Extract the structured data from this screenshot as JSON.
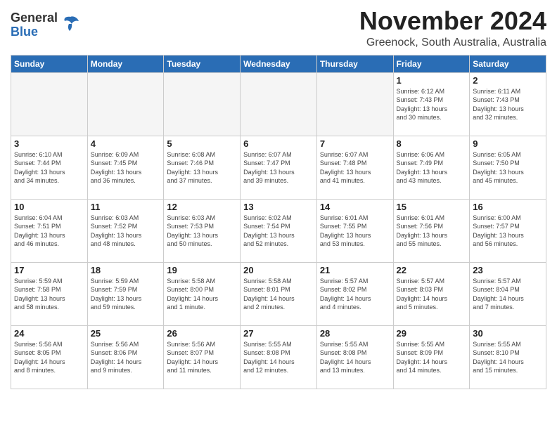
{
  "header": {
    "logo_general": "General",
    "logo_blue": "Blue",
    "month_title": "November 2024",
    "location": "Greenock, South Australia, Australia"
  },
  "days_of_week": [
    "Sunday",
    "Monday",
    "Tuesday",
    "Wednesday",
    "Thursday",
    "Friday",
    "Saturday"
  ],
  "weeks": [
    [
      {
        "day": "",
        "info": ""
      },
      {
        "day": "",
        "info": ""
      },
      {
        "day": "",
        "info": ""
      },
      {
        "day": "",
        "info": ""
      },
      {
        "day": "",
        "info": ""
      },
      {
        "day": "1",
        "info": "Sunrise: 6:12 AM\nSunset: 7:43 PM\nDaylight: 13 hours\nand 30 minutes."
      },
      {
        "day": "2",
        "info": "Sunrise: 6:11 AM\nSunset: 7:43 PM\nDaylight: 13 hours\nand 32 minutes."
      }
    ],
    [
      {
        "day": "3",
        "info": "Sunrise: 6:10 AM\nSunset: 7:44 PM\nDaylight: 13 hours\nand 34 minutes."
      },
      {
        "day": "4",
        "info": "Sunrise: 6:09 AM\nSunset: 7:45 PM\nDaylight: 13 hours\nand 36 minutes."
      },
      {
        "day": "5",
        "info": "Sunrise: 6:08 AM\nSunset: 7:46 PM\nDaylight: 13 hours\nand 37 minutes."
      },
      {
        "day": "6",
        "info": "Sunrise: 6:07 AM\nSunset: 7:47 PM\nDaylight: 13 hours\nand 39 minutes."
      },
      {
        "day": "7",
        "info": "Sunrise: 6:07 AM\nSunset: 7:48 PM\nDaylight: 13 hours\nand 41 minutes."
      },
      {
        "day": "8",
        "info": "Sunrise: 6:06 AM\nSunset: 7:49 PM\nDaylight: 13 hours\nand 43 minutes."
      },
      {
        "day": "9",
        "info": "Sunrise: 6:05 AM\nSunset: 7:50 PM\nDaylight: 13 hours\nand 45 minutes."
      }
    ],
    [
      {
        "day": "10",
        "info": "Sunrise: 6:04 AM\nSunset: 7:51 PM\nDaylight: 13 hours\nand 46 minutes."
      },
      {
        "day": "11",
        "info": "Sunrise: 6:03 AM\nSunset: 7:52 PM\nDaylight: 13 hours\nand 48 minutes."
      },
      {
        "day": "12",
        "info": "Sunrise: 6:03 AM\nSunset: 7:53 PM\nDaylight: 13 hours\nand 50 minutes."
      },
      {
        "day": "13",
        "info": "Sunrise: 6:02 AM\nSunset: 7:54 PM\nDaylight: 13 hours\nand 52 minutes."
      },
      {
        "day": "14",
        "info": "Sunrise: 6:01 AM\nSunset: 7:55 PM\nDaylight: 13 hours\nand 53 minutes."
      },
      {
        "day": "15",
        "info": "Sunrise: 6:01 AM\nSunset: 7:56 PM\nDaylight: 13 hours\nand 55 minutes."
      },
      {
        "day": "16",
        "info": "Sunrise: 6:00 AM\nSunset: 7:57 PM\nDaylight: 13 hours\nand 56 minutes."
      }
    ],
    [
      {
        "day": "17",
        "info": "Sunrise: 5:59 AM\nSunset: 7:58 PM\nDaylight: 13 hours\nand 58 minutes."
      },
      {
        "day": "18",
        "info": "Sunrise: 5:59 AM\nSunset: 7:59 PM\nDaylight: 13 hours\nand 59 minutes."
      },
      {
        "day": "19",
        "info": "Sunrise: 5:58 AM\nSunset: 8:00 PM\nDaylight: 14 hours\nand 1 minute."
      },
      {
        "day": "20",
        "info": "Sunrise: 5:58 AM\nSunset: 8:01 PM\nDaylight: 14 hours\nand 2 minutes."
      },
      {
        "day": "21",
        "info": "Sunrise: 5:57 AM\nSunset: 8:02 PM\nDaylight: 14 hours\nand 4 minutes."
      },
      {
        "day": "22",
        "info": "Sunrise: 5:57 AM\nSunset: 8:03 PM\nDaylight: 14 hours\nand 5 minutes."
      },
      {
        "day": "23",
        "info": "Sunrise: 5:57 AM\nSunset: 8:04 PM\nDaylight: 14 hours\nand 7 minutes."
      }
    ],
    [
      {
        "day": "24",
        "info": "Sunrise: 5:56 AM\nSunset: 8:05 PM\nDaylight: 14 hours\nand 8 minutes."
      },
      {
        "day": "25",
        "info": "Sunrise: 5:56 AM\nSunset: 8:06 PM\nDaylight: 14 hours\nand 9 minutes."
      },
      {
        "day": "26",
        "info": "Sunrise: 5:56 AM\nSunset: 8:07 PM\nDaylight: 14 hours\nand 11 minutes."
      },
      {
        "day": "27",
        "info": "Sunrise: 5:55 AM\nSunset: 8:08 PM\nDaylight: 14 hours\nand 12 minutes."
      },
      {
        "day": "28",
        "info": "Sunrise: 5:55 AM\nSunset: 8:08 PM\nDaylight: 14 hours\nand 13 minutes."
      },
      {
        "day": "29",
        "info": "Sunrise: 5:55 AM\nSunset: 8:09 PM\nDaylight: 14 hours\nand 14 minutes."
      },
      {
        "day": "30",
        "info": "Sunrise: 5:55 AM\nSunset: 8:10 PM\nDaylight: 14 hours\nand 15 minutes."
      }
    ]
  ]
}
